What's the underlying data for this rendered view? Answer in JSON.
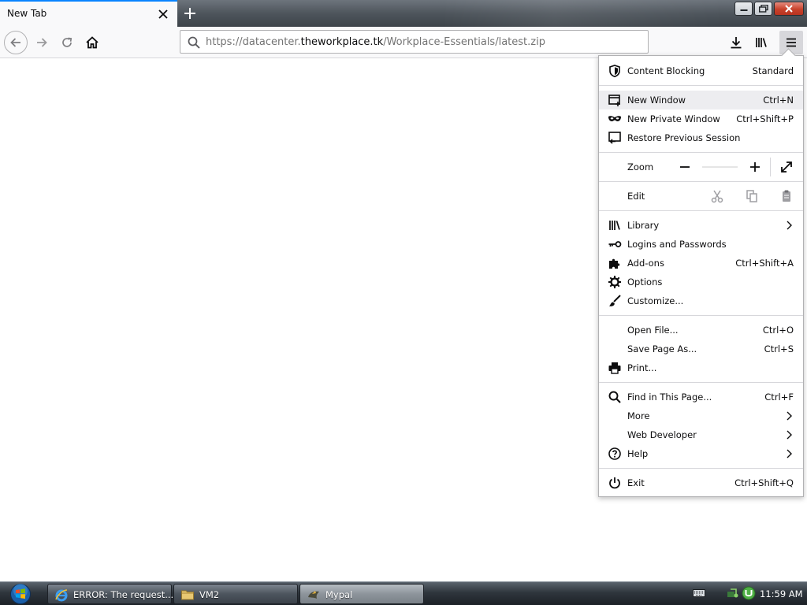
{
  "browser": {
    "tab": {
      "title": "New Tab"
    },
    "url": {
      "prefix": "https://datacenter.",
      "host": "theworkplace.tk",
      "path": "/Workplace-Essentials/latest.zip"
    }
  },
  "app_menu": {
    "content_blocking": {
      "label": "Content Blocking",
      "value": "Standard"
    },
    "new_window": {
      "label": "New Window",
      "shortcut": "Ctrl+N"
    },
    "new_private_window": {
      "label": "New Private Window",
      "shortcut": "Ctrl+Shift+P"
    },
    "restore_session": {
      "label": "Restore Previous Session"
    },
    "zoom": {
      "label": "Zoom"
    },
    "edit": {
      "label": "Edit"
    },
    "library": {
      "label": "Library"
    },
    "logins": {
      "label": "Logins and Passwords"
    },
    "addons": {
      "label": "Add-ons",
      "shortcut": "Ctrl+Shift+A"
    },
    "options": {
      "label": "Options"
    },
    "customize": {
      "label": "Customize..."
    },
    "open_file": {
      "label": "Open File...",
      "shortcut": "Ctrl+O"
    },
    "save_page": {
      "label": "Save Page As...",
      "shortcut": "Ctrl+S"
    },
    "print": {
      "label": "Print..."
    },
    "find": {
      "label": "Find in This Page...",
      "shortcut": "Ctrl+F"
    },
    "more": {
      "label": "More"
    },
    "web_developer": {
      "label": "Web Developer"
    },
    "help": {
      "label": "Help"
    },
    "exit": {
      "label": "Exit",
      "shortcut": "Ctrl+Shift+Q"
    }
  },
  "taskbar": {
    "tasks": [
      {
        "label": "ERROR: The request...",
        "icon": "ie-icon"
      },
      {
        "label": "VM2",
        "icon": "folder-icon"
      },
      {
        "label": "Mypal",
        "icon": "mypal-icon"
      }
    ],
    "clock": "11:59 AM"
  }
}
